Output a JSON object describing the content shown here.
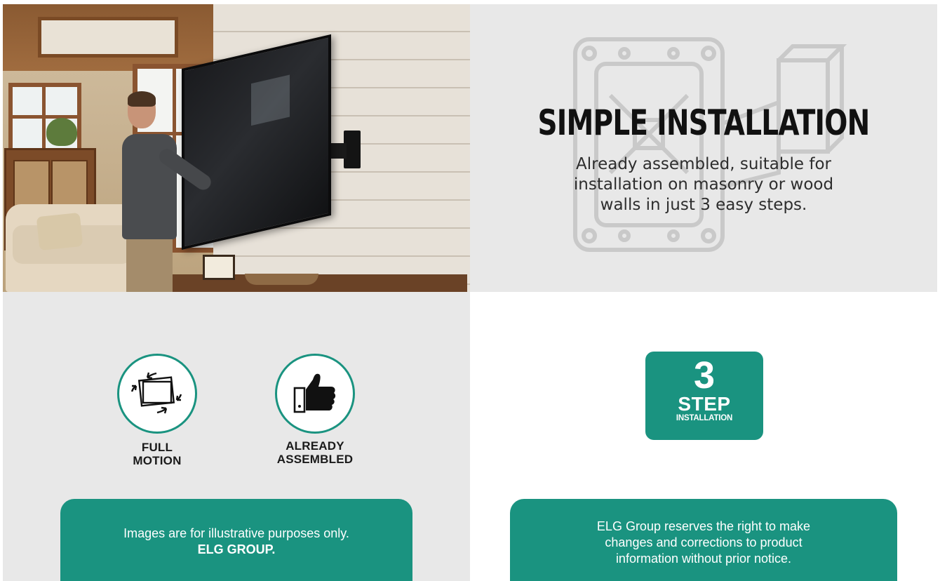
{
  "install": {
    "title": "SIMPLE INSTALLATION",
    "description_lines": [
      "Already assembled, suitable for",
      "installation on masonry or wood",
      "walls in just 3 easy steps."
    ]
  },
  "features": [
    {
      "icon": "rotating-tv-icon",
      "label_lines": [
        "FULL",
        "MOTION"
      ]
    },
    {
      "icon": "thumbs-up-icon",
      "label_lines": [
        "ALREADY",
        "ASSEMBLED"
      ]
    }
  ],
  "badge": {
    "number": "3",
    "line1": "STEP",
    "line2": "INSTALLATION"
  },
  "notes": {
    "left_line1": "Images are for illustrative purposes only.",
    "left_line2": "ELG GROUP.",
    "right_lines": [
      "ELG Group reserves the right to make",
      "changes and corrections to product",
      "information without prior notice."
    ]
  },
  "colors": {
    "accent": "#1a9380",
    "panel_gray": "#e8e8e8",
    "title_dark": "#111111"
  }
}
